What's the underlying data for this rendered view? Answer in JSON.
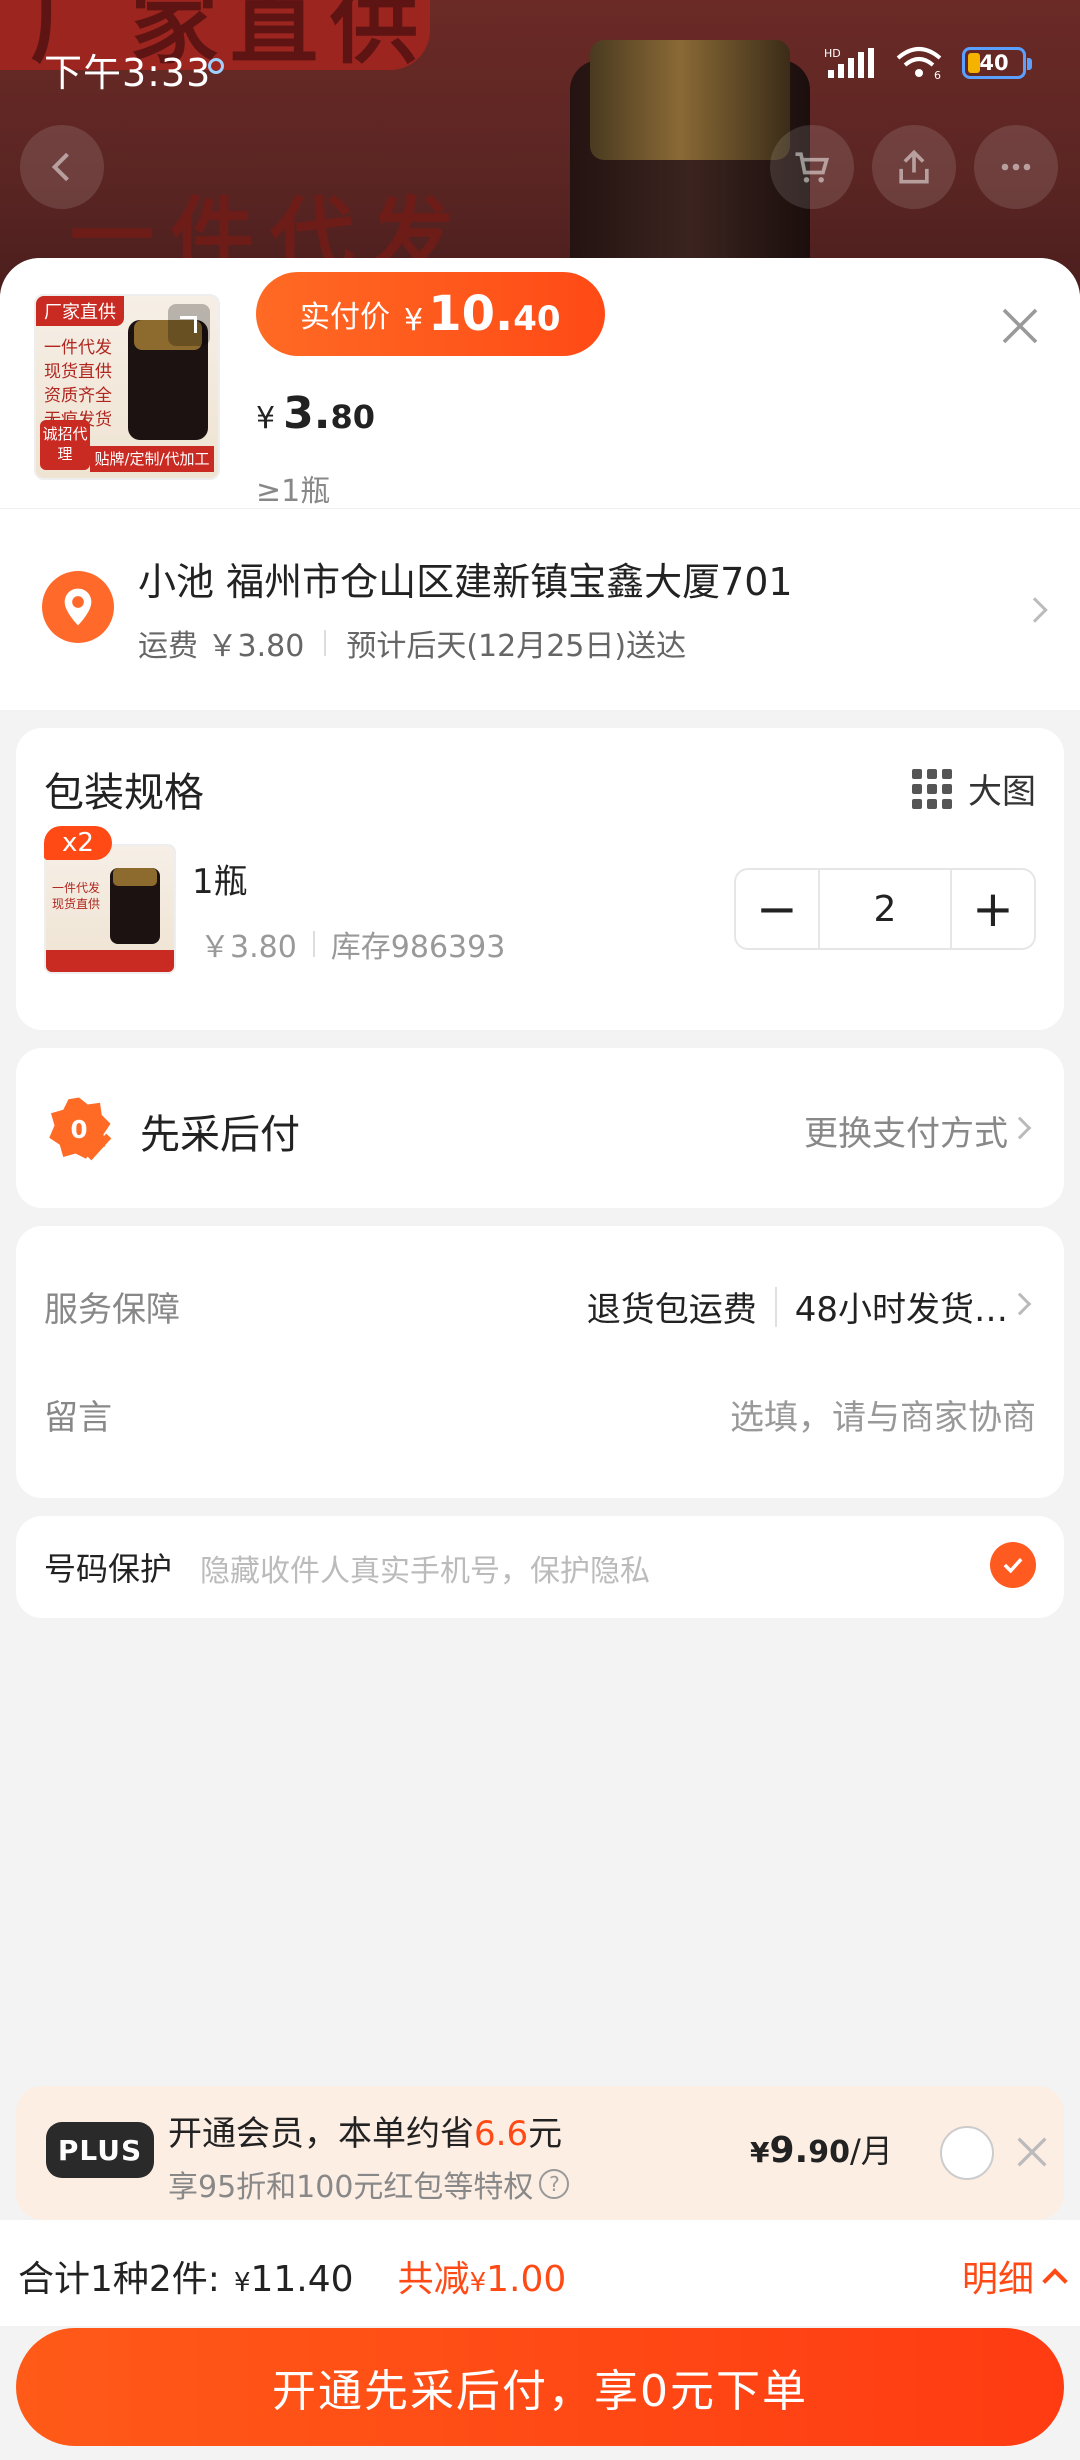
{
  "status_bar": {
    "time": "下午3:33",
    "network": "HD",
    "wifi_label": "6",
    "battery": "40"
  },
  "background_page": {
    "banner_text": "厂家直供",
    "label_text": "一件代发"
  },
  "product": {
    "thumb_tag": "厂家直供",
    "thumb_lines": [
      "一件代发",
      "现货直供",
      "资质齐全",
      "无痕发货"
    ],
    "thumb_seal": "诚招代理",
    "thumb_footer": "贴牌/定制/代加工",
    "actual_price_label": "实付价",
    "actual_price_currency": "¥",
    "actual_price_int": "10.",
    "actual_price_dec": "40",
    "unit_price_currency": "¥",
    "unit_price_int": "3.",
    "unit_price_dec": "80",
    "min_qty": "≥1瓶"
  },
  "address": {
    "name_line": "小池 福州市仓山区建新镇宝鑫大厦701",
    "shipping": "运费 ￥3.80",
    "eta": "预计后天(12月25日)送达"
  },
  "spec": {
    "title": "包装规格",
    "big_view": "大图",
    "badge": "x2",
    "name": "1瓶",
    "price": "￥3.80",
    "stock": "库存986393",
    "quantity": "2",
    "minus": "−",
    "plus": "+"
  },
  "payment": {
    "title": "先采后付",
    "change": "更换支付方式"
  },
  "service": {
    "label": "服务保障",
    "item1": "退货包运费",
    "item2": "48小时发货…",
    "message_label": "留言",
    "message_placeholder": "选填，请与商家协商"
  },
  "privacy": {
    "label": "号码保护",
    "desc": "隐藏收件人真实手机号，保护隐私",
    "checked": true
  },
  "membership": {
    "badge": "PLUS",
    "line1_prefix": "开通会员，本单约省",
    "line1_amount": "6.6",
    "line1_suffix": "元",
    "line2": "享95折和100元红包等特权",
    "price_currency": "¥",
    "price_int": "9.",
    "price_dec": "90",
    "price_unit": "/月"
  },
  "summary": {
    "count": "合计1种2件:",
    "total_currency": "¥",
    "total": "11.40",
    "discount_label": "共减",
    "discount_currency": "¥",
    "discount": "1.00",
    "detail": "明细"
  },
  "cta": {
    "label": "开通先采后付，享0元下单"
  },
  "colors": {
    "accent": "#ff4a16",
    "accent_light": "#ff6a24",
    "plus_bg": "#fdeee4"
  }
}
